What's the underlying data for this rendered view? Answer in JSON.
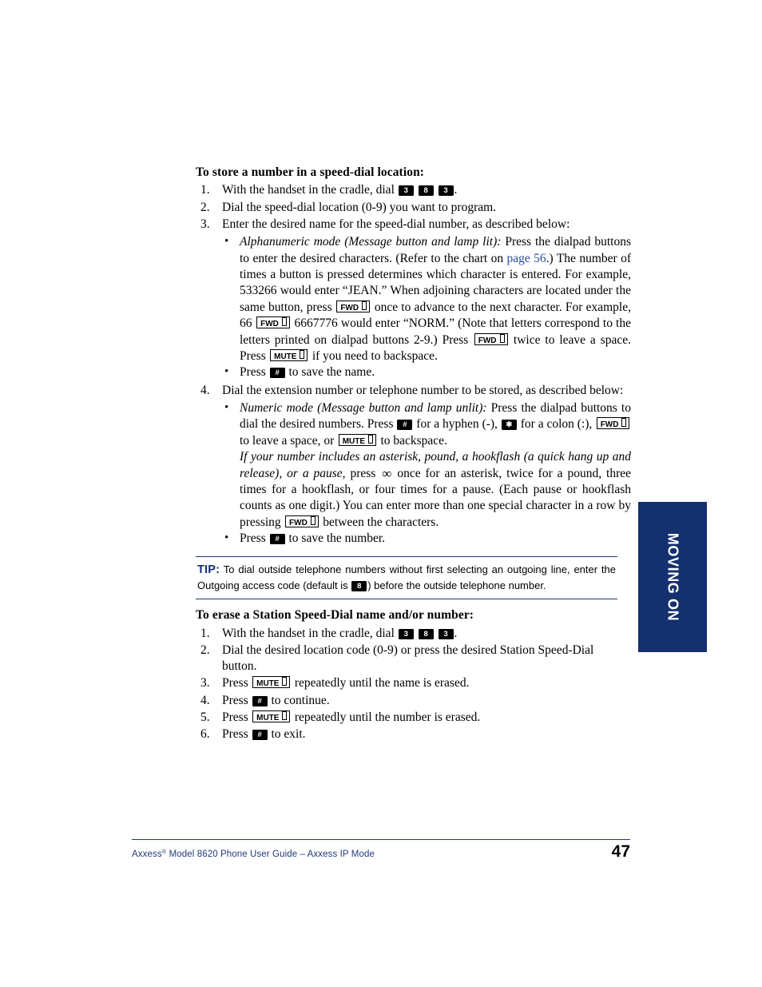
{
  "document": {
    "page_number": "47",
    "footer_text_before": "Axxess",
    "footer_sup": "®",
    "footer_text_after": " Model 8620 Phone User Guide – Axxess IP Mode",
    "side_tab_label": "MOVING ON",
    "accent_navy": "#14306e",
    "rule_navy": "#1d3a76",
    "link_blue": "#2b4fa2"
  },
  "keys": {
    "three": "3",
    "eight": "8",
    "pound": "#",
    "asterisk": "✱",
    "fwd": "FWD",
    "mute": "MUTE",
    "spcl_glyph": "∞"
  },
  "section1": {
    "heading": "To store a number in a speed-dial location:",
    "step1_before": "With the handset in the cradle, dial ",
    "step1_after": ".",
    "step2": "Dial the speed-dial location (0-9) you want to program.",
    "step3": "Enter the desired name for the speed-dial number, as described below:",
    "alpha_italic": "Alphanumeric mode (Message button and lamp lit):",
    "alpha_t1": " Press the dialpad buttons to enter the desired characters. (Refer to the chart on ",
    "alpha_link": "page 56",
    "alpha_t2": ".) The number of times a button is pressed determines which character is entered. For example, 533266 would enter “JEAN.” When adjoining characters are located under the same button, press ",
    "alpha_t3": " once to advance to the next character. For example, 66 ",
    "alpha_t4": " 6667776 would enter “NORM.” (Note that letters correspond to the letters printed on dialpad buttons 2-9.) Press ",
    "alpha_t5": " twice to leave a space. Press ",
    "alpha_t6": " if you need to backspace.",
    "save_name_before": "Press ",
    "save_name_after": " to save the name.",
    "step4": "Dial the extension number or telephone number to be stored, as described below:",
    "num_italic": "Numeric mode (Message button and lamp unlit):",
    "num_t1": " Press the dialpad buttons to dial the desired numbers. Press ",
    "num_t2": " for a hyphen (-), ",
    "num_t3": " for a colon (:), ",
    "num_t4": " to leave a space, or ",
    "num_t5": " to backspace.",
    "spcl_italic": "If your number includes an asterisk, pound, a hookflash (a quick hang up and release), or a pause,",
    "spcl_t1": " press ",
    "spcl_t2": " once for an asterisk, twice for a pound, three times for a hookflash, or four times for a pause. (Each pause or hookflash counts as one digit.) You can enter more than one special character in a row by pressing ",
    "spcl_t3": " between the characters.",
    "save_number_before": "Press ",
    "save_number_after": " to save the number."
  },
  "tip": {
    "label": "TIP:",
    "text_part1": " To dial outside telephone numbers without first selecting an outgoing line, enter the Outgoing access code (default is ",
    "text_part2": ") before the outside telephone number."
  },
  "section2": {
    "heading": "To erase a Station Speed-Dial name and/or number:",
    "step1_before": "With the handset in the cradle, dial ",
    "step1_after": ".",
    "step2": "Dial the desired location code (0-9) or press the desired Station Speed-Dial button.",
    "step3_before": "Press ",
    "step3_after": " repeatedly until the name is erased.",
    "step4_before": "Press ",
    "step4_after": " to continue.",
    "step5_before": "Press ",
    "step5_after": " repeatedly until the number is erased.",
    "step6_before": "Press ",
    "step6_after": " to exit.",
    "numbers": [
      "1.",
      "2.",
      "3.",
      "4.",
      "5.",
      "6."
    ]
  },
  "step_numbers": [
    "1.",
    "2.",
    "3.",
    "4."
  ]
}
